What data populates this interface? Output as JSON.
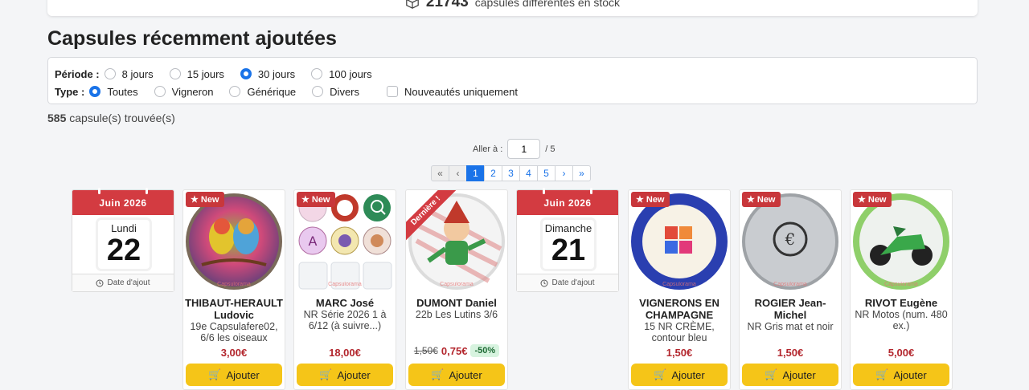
{
  "stock": {
    "count": "21743",
    "text": "capsules différentes en stock"
  },
  "title": "Capsules récemment ajoutées",
  "filters": {
    "periode_label": "Période :",
    "periode_options": [
      "8 jours",
      "15 jours",
      "30 jours",
      "100 jours"
    ],
    "periode_selected": "30 jours",
    "type_label": "Type :",
    "type_options": [
      "Toutes",
      "Vigneron",
      "Générique",
      "Divers"
    ],
    "type_selected": "Toutes",
    "nouveautes_label": "Nouveautés uniquement"
  },
  "results": {
    "count": "585",
    "text": "capsule(s) trouvée(s)"
  },
  "goto": {
    "label": "Aller à :",
    "value": "1",
    "total": "/ 5"
  },
  "pagination": [
    "«",
    "‹",
    "1",
    "2",
    "3",
    "4",
    "5",
    "›",
    "»"
  ],
  "calendars": [
    {
      "month": "Juin 2026",
      "dayname": "Lundi",
      "day": "22",
      "footer": "Date d'ajout"
    },
    {
      "month": "Juin 2026",
      "dayname": "Dimanche",
      "day": "21",
      "footer": "Date d'ajout"
    }
  ],
  "cards": [
    {
      "badge": "New",
      "name": "THIBAUT-HERAULT Ludovic",
      "desc": "19e Capsulafere02, 6/6 les oiseaux",
      "price": "3,00€",
      "button": "Ajouter",
      "watermark": "Capsulorama"
    },
    {
      "badge": "New",
      "name": "MARC José",
      "desc": "NR Série 2026 1 à 6/12 (à suivre...)",
      "price": "18,00€",
      "button": "Ajouter",
      "watermark": "Capsulorama"
    },
    {
      "ribbon": "Dernière !",
      "name": "DUMONT Daniel",
      "desc": "22b Les Lutins 3/6",
      "old_price": "1,50€",
      "price": "0,75€",
      "discount": "-50%",
      "button": "Ajouter",
      "watermark": "Capsulorama"
    },
    {
      "badge": "New",
      "name": "VIGNERONS EN CHAMPAGNE",
      "desc": "15 NR CRÈME, contour bleu",
      "price": "1,50€",
      "button": "Ajouter",
      "watermark": "Capsulorama"
    },
    {
      "badge": "New",
      "name": "ROGIER Jean-Michel",
      "desc": "NR Gris mat et noir",
      "price": "1,50€",
      "button": "Ajouter",
      "watermark": "Capsulorama"
    },
    {
      "badge": "New",
      "name": "RIVOT Eugène",
      "desc": "NR Motos (num. 480 ex.)",
      "price": "5,00€",
      "button": "Ajouter",
      "watermark": "Capsulorama"
    }
  ],
  "colors": {
    "accent": "#1a73e8",
    "calendar_red": "#d33b41",
    "price_red": "#b3262d",
    "button_yellow": "#f5c518"
  }
}
